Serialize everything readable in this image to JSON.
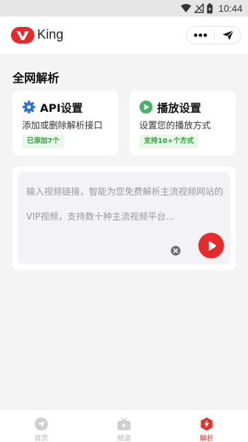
{
  "status_bar": {
    "time": "10:44"
  },
  "header": {
    "logo_text": "King",
    "brand_color": "#e52b2b"
  },
  "section": {
    "title": "全网解析"
  },
  "cards": [
    {
      "title": "API设置",
      "description": "添加或删除解析接口",
      "badge": "已添加7个",
      "icon": "gear-icon"
    },
    {
      "title": "播放设置",
      "description": "设置您的播放方式",
      "badge": "支持10+个方式",
      "icon": "play-circle-icon"
    }
  ],
  "input": {
    "placeholder": "输入视频链接，智能为您免费解析主流视频网站的VIP视频，支持数十种主流视频平台...",
    "value": ""
  },
  "tabs": [
    {
      "label": "首页",
      "icon": "paper-plane-icon",
      "active": false
    },
    {
      "label": "频道",
      "icon": "tv-icon",
      "active": false
    },
    {
      "label": "解析",
      "icon": "bolt-icon",
      "active": true
    }
  ],
  "colors": {
    "accent": "#e52b2b",
    "badge_text": "#2e9e3c",
    "badge_bg": "#e8f7ea",
    "gear_blue": "#2f6fd6",
    "play_green": "#4caf6a"
  }
}
